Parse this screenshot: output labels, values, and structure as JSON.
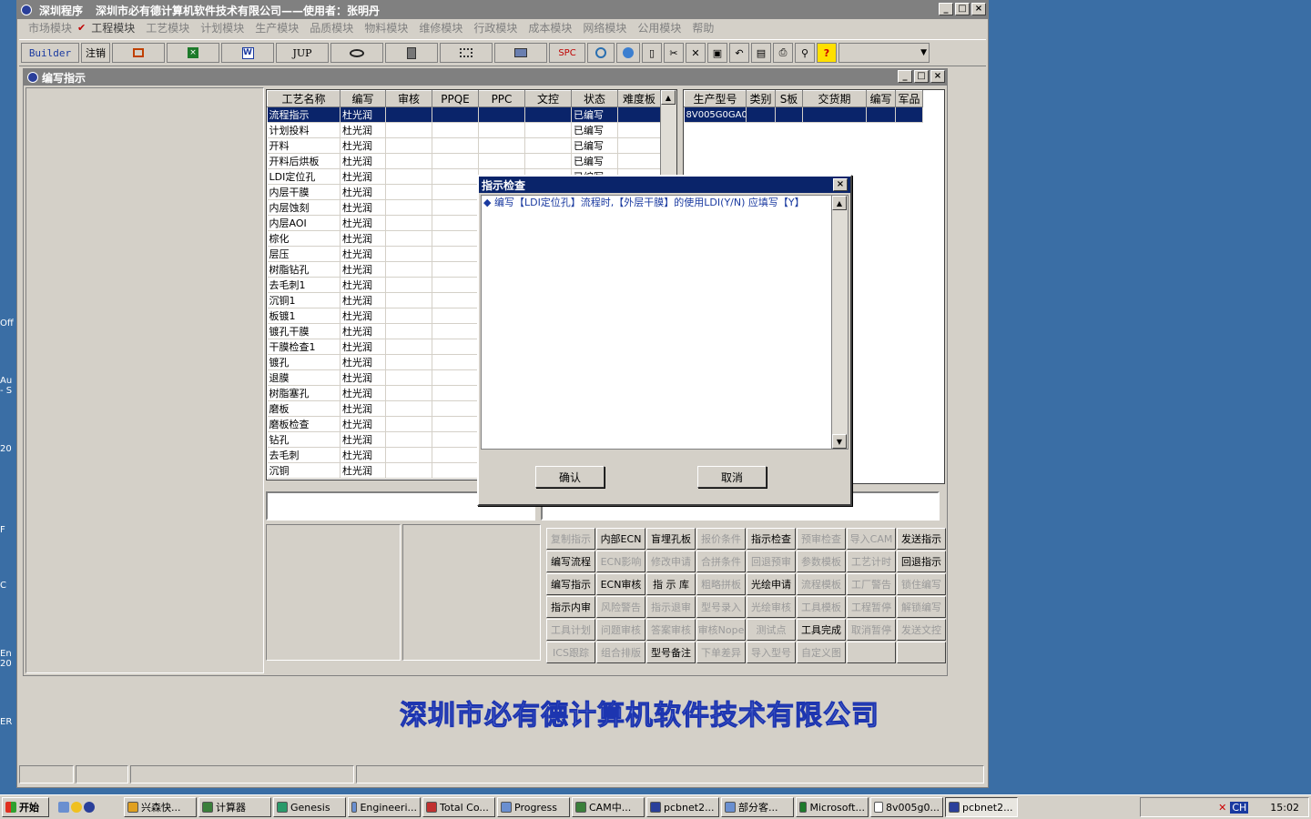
{
  "desktop": {
    "labels": [
      "Off",
      "Au\n- S",
      "20",
      "F",
      "C",
      "En\n20",
      "ER"
    ]
  },
  "window": {
    "title_app": "深圳程序",
    "title_company": "深圳市必有德计算机软件技术有限公司——使用者：张明丹",
    "btn_min": "_",
    "btn_max": "□",
    "btn_close": "×"
  },
  "menu": [
    "市场模块",
    "工程模块",
    "工艺模块",
    "计划模块",
    "生产模块",
    "品质模块",
    "物料模块",
    "维修模块",
    "行政模块",
    "成本模块",
    "网络模块",
    "公用模块",
    "帮助"
  ],
  "menu_checked": "✔",
  "toolbar": {
    "builder": "Builder",
    "logout": "注销",
    "jup": "JUP",
    "spc": "SPC",
    "help": "?"
  },
  "child": {
    "title": "编写指示"
  },
  "process_table": {
    "headers": [
      "工艺名称",
      "编写",
      "审核",
      "PPQE",
      "PPC",
      "文控",
      "状态",
      "难度板"
    ],
    "rows": [
      [
        "流程指示",
        "杜光润",
        "",
        "",
        "",
        "",
        "已编写",
        ""
      ],
      [
        "计划投料",
        "杜光润",
        "",
        "",
        "",
        "",
        "已编写",
        ""
      ],
      [
        "开料",
        "杜光润",
        "",
        "",
        "",
        "",
        "已编写",
        ""
      ],
      [
        "开料后烘板",
        "杜光润",
        "",
        "",
        "",
        "",
        "已编写",
        ""
      ],
      [
        "LDI定位孔",
        "杜光润",
        "",
        "",
        "",
        "",
        "已编写",
        ""
      ],
      [
        "内层干膜",
        "杜光润",
        "",
        "",
        "",
        "",
        "",
        ""
      ],
      [
        "内层蚀刻",
        "杜光润",
        "",
        "",
        "",
        "",
        "",
        ""
      ],
      [
        "内层AOI",
        "杜光润",
        "",
        "",
        "",
        "",
        "",
        ""
      ],
      [
        "棕化",
        "杜光润",
        "",
        "",
        "",
        "",
        "",
        ""
      ],
      [
        "层压",
        "杜光润",
        "",
        "",
        "",
        "",
        "",
        ""
      ],
      [
        "树脂钻孔",
        "杜光润",
        "",
        "",
        "",
        "",
        "",
        ""
      ],
      [
        "去毛刺1",
        "杜光润",
        "",
        "",
        "",
        "",
        "",
        ""
      ],
      [
        "沉铜1",
        "杜光润",
        "",
        "",
        "",
        "",
        "",
        ""
      ],
      [
        "板镀1",
        "杜光润",
        "",
        "",
        "",
        "",
        "",
        ""
      ],
      [
        "镀孔干膜",
        "杜光润",
        "",
        "",
        "",
        "",
        "",
        ""
      ],
      [
        "干膜检查1",
        "杜光润",
        "",
        "",
        "",
        "",
        "",
        ""
      ],
      [
        "镀孔",
        "杜光润",
        "",
        "",
        "",
        "",
        "",
        ""
      ],
      [
        "退膜",
        "杜光润",
        "",
        "",
        "",
        "",
        "",
        ""
      ],
      [
        "树脂塞孔",
        "杜光润",
        "",
        "",
        "",
        "",
        "",
        ""
      ],
      [
        "磨板",
        "杜光润",
        "",
        "",
        "",
        "",
        "",
        ""
      ],
      [
        "磨板检查",
        "杜光润",
        "",
        "",
        "",
        "",
        "",
        ""
      ],
      [
        "钻孔",
        "杜光润",
        "",
        "",
        "",
        "",
        "",
        ""
      ],
      [
        "去毛刺",
        "杜光润",
        "",
        "",
        "",
        "",
        "",
        ""
      ],
      [
        "沉铜",
        "杜光润",
        "",
        "",
        "",
        "",
        "",
        ""
      ]
    ]
  },
  "order_table": {
    "headers": [
      "生产型号",
      "类别",
      "S板",
      "交货期",
      "编写",
      "军品"
    ],
    "rows": [
      [
        "8V005G0GA0",
        "",
        "",
        "",
        "",
        ""
      ]
    ]
  },
  "buttons": [
    {
      "label": "复制指示",
      "enabled": false
    },
    {
      "label": "内部ECN",
      "enabled": true
    },
    {
      "label": "盲埋孔板",
      "enabled": true
    },
    {
      "label": "报价条件",
      "enabled": false
    },
    {
      "label": "指示检查",
      "enabled": true
    },
    {
      "label": "预审检查",
      "enabled": false
    },
    {
      "label": "导入CAM",
      "enabled": false
    },
    {
      "label": "发送指示",
      "enabled": true
    },
    {
      "label": "编写流程",
      "enabled": true
    },
    {
      "label": "ECN影响",
      "enabled": false
    },
    {
      "label": "修改申请",
      "enabled": false
    },
    {
      "label": "合拼条件",
      "enabled": false
    },
    {
      "label": "回退预审",
      "enabled": false
    },
    {
      "label": "参数模板",
      "enabled": false
    },
    {
      "label": "工艺计时",
      "enabled": false
    },
    {
      "label": "回退指示",
      "enabled": true
    },
    {
      "label": "编写指示",
      "enabled": true
    },
    {
      "label": "ECN审核",
      "enabled": true
    },
    {
      "label": "指 示 库",
      "enabled": true
    },
    {
      "label": "粗略拼板",
      "enabled": false
    },
    {
      "label": "光绘申请",
      "enabled": true
    },
    {
      "label": "流程模板",
      "enabled": false
    },
    {
      "label": "工厂警告",
      "enabled": false
    },
    {
      "label": "锁住编写",
      "enabled": false
    },
    {
      "label": "指示内审",
      "enabled": true
    },
    {
      "label": "风险警告",
      "enabled": false
    },
    {
      "label": "指示退审",
      "enabled": false
    },
    {
      "label": "型号录入",
      "enabled": false
    },
    {
      "label": "光绘审核",
      "enabled": false
    },
    {
      "label": "工具模板",
      "enabled": false
    },
    {
      "label": "工程暂停",
      "enabled": false
    },
    {
      "label": "解锁编写",
      "enabled": false
    },
    {
      "label": "工具计划",
      "enabled": false
    },
    {
      "label": "问题审核",
      "enabled": false
    },
    {
      "label": "答案审核",
      "enabled": false
    },
    {
      "label": "审核Nope",
      "enabled": false
    },
    {
      "label": "测试点",
      "enabled": false
    },
    {
      "label": "工具完成",
      "enabled": true
    },
    {
      "label": "取消暂停",
      "enabled": false
    },
    {
      "label": "发送文控",
      "enabled": false
    },
    {
      "label": "ICS跟踪",
      "enabled": false
    },
    {
      "label": "组合排版",
      "enabled": false
    },
    {
      "label": "型号备注",
      "enabled": true
    },
    {
      "label": "下单差异",
      "enabled": false
    },
    {
      "label": "导入型号",
      "enabled": false
    },
    {
      "label": "自定义图",
      "enabled": false
    },
    {
      "label": "",
      "enabled": false
    },
    {
      "label": "",
      "enabled": false
    }
  ],
  "dialog": {
    "title": "指示检查",
    "message": "编写【LDI定位孔】流程时,【外层干膜】的使用LDI(Y/N) 应填写【Y】",
    "confirm": "确认",
    "cancel": "取消"
  },
  "logo_text": "深圳市必有德计算机软件技术有限公司",
  "taskbar": {
    "start": "开始",
    "tasks": [
      "兴森快...",
      "计算器",
      "Genesis",
      "Engineeri...",
      "Total Co...",
      "Progress",
      "CAM中...",
      "pcbnet2...",
      "部分客...",
      "Microsoft...",
      "8v005g0...",
      "pcbnet2..."
    ],
    "clock": "15:02",
    "lang": "CH"
  },
  "colors": {
    "selection": "#0a246a",
    "desktop": "#3a6ea5",
    "face": "#d4d0c8"
  }
}
